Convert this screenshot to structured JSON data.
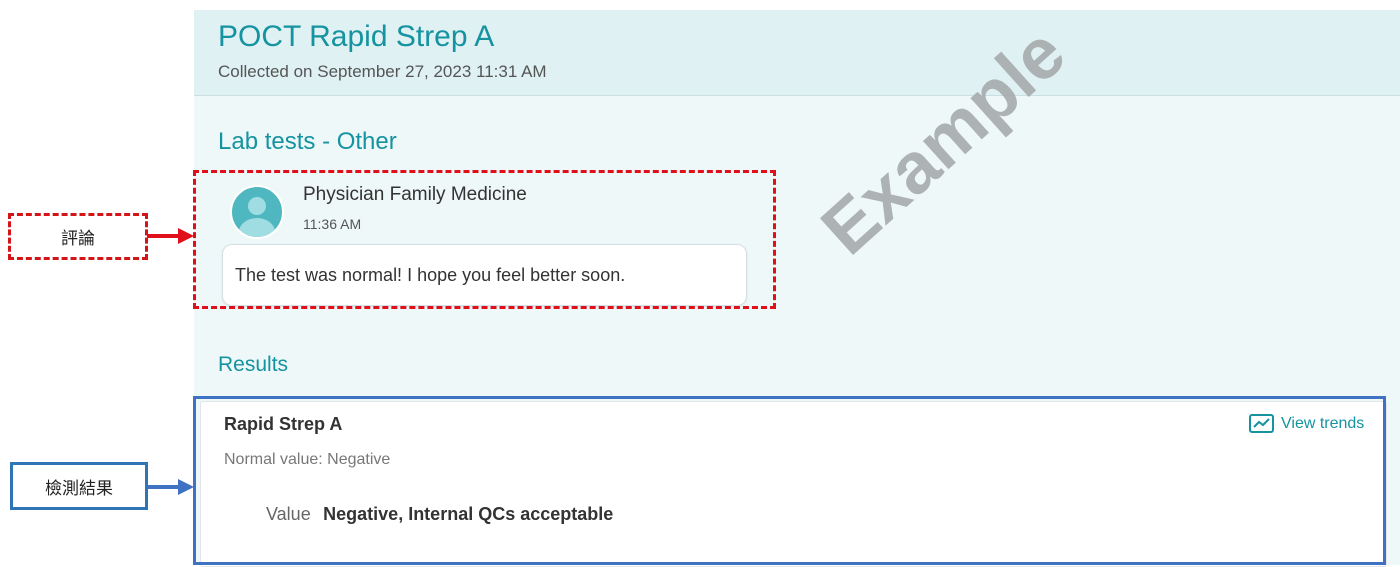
{
  "header": {
    "title": "POCT Rapid Strep A",
    "subtitle": "Collected on September 27, 2023 11:31 AM"
  },
  "section": {
    "title": "Lab tests - Other"
  },
  "comment": {
    "author": "Physician Family Medicine",
    "time": "11:36 AM",
    "text": "The test was normal! I hope you feel better soon."
  },
  "results": {
    "title": "Results",
    "name": "Rapid Strep A",
    "normal_value": "Normal value: Negative",
    "value_label": "Value",
    "value": "Negative, Internal QCs acceptable",
    "view_trends": "View trends"
  },
  "watermark": "Example",
  "annotations": {
    "comment_label": "評論",
    "result_label": "檢測結果",
    "comment_color": "#e0101a",
    "result_color": "#4072c4"
  },
  "colors": {
    "accent": "#1593a0",
    "header_background": "#dff1f3",
    "panel_background": "#eef8f9"
  },
  "icons": {
    "avatar": "user-avatar-icon",
    "trend": "trend-chart-icon"
  }
}
